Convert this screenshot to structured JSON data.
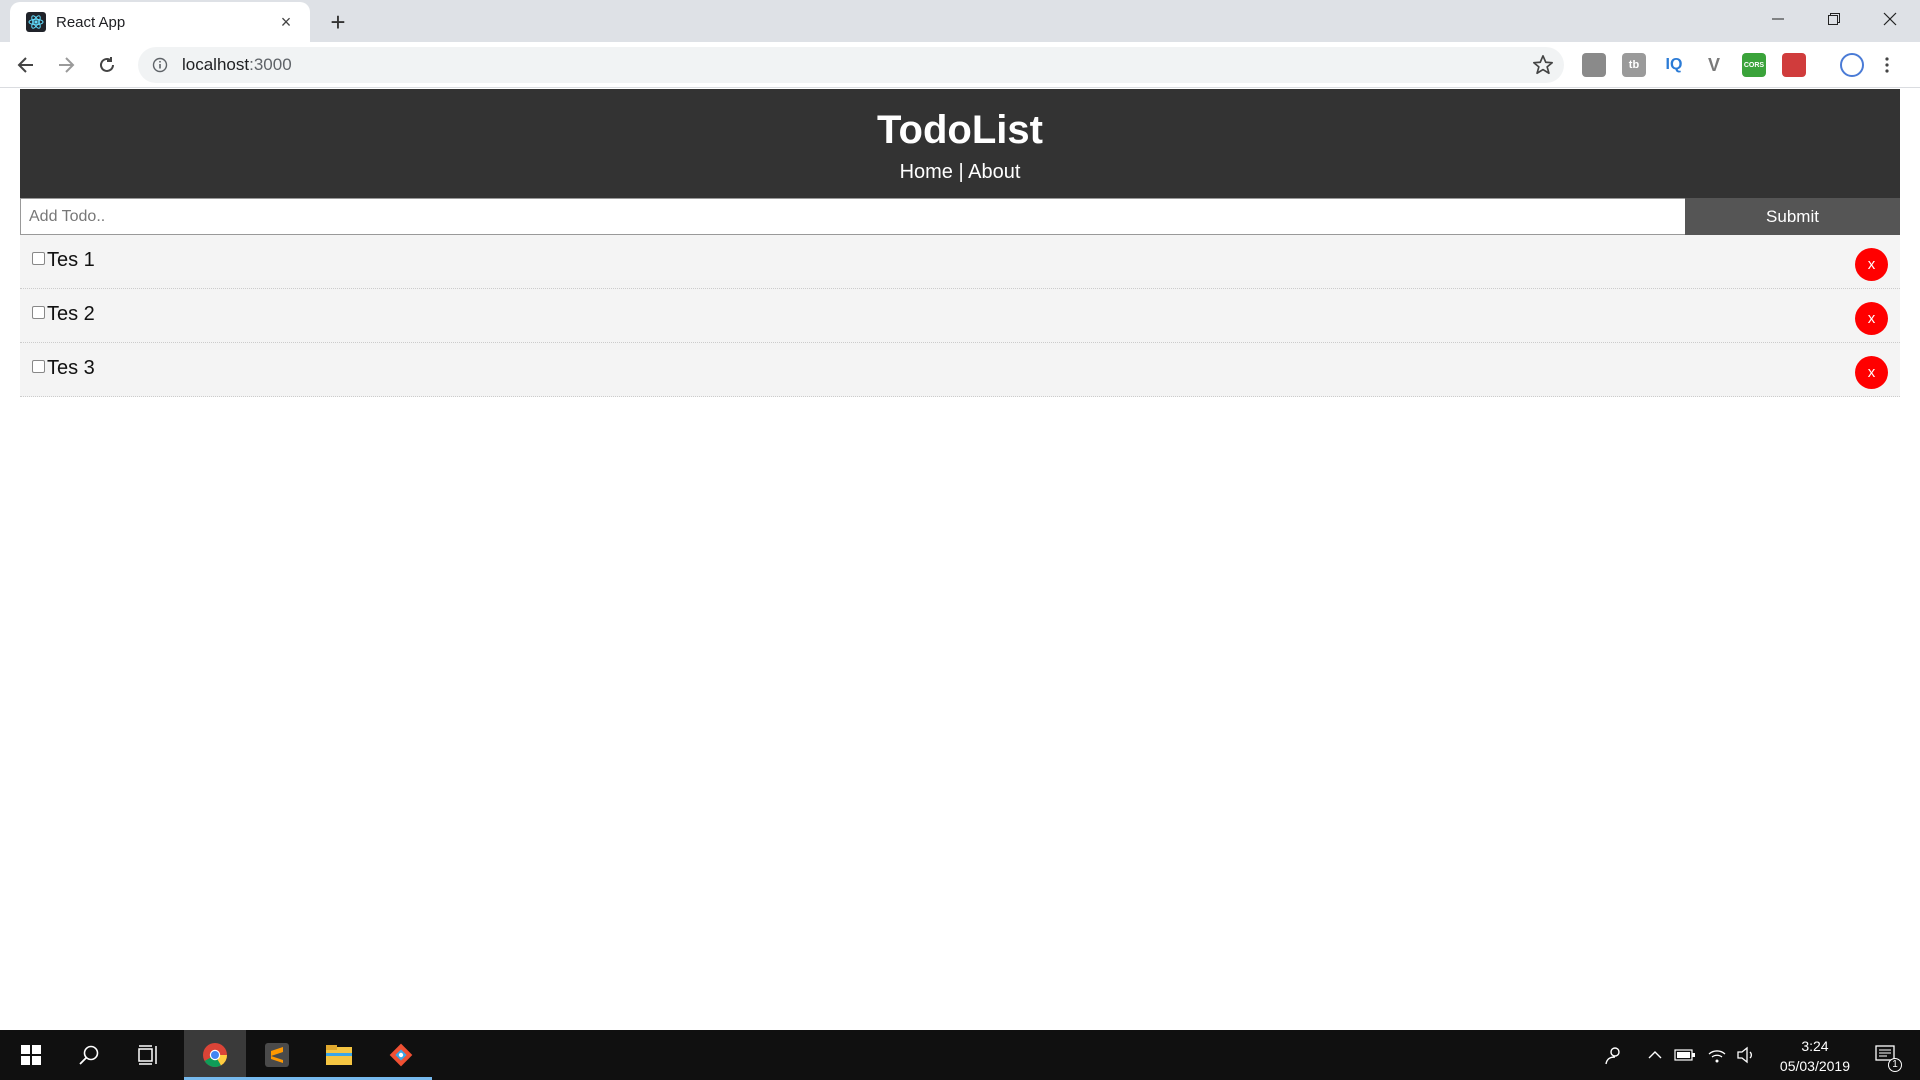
{
  "browser": {
    "tab_title": "React App",
    "new_tab_symbol": "+",
    "tab_close_symbol": "×",
    "url_host": "localhost",
    "url_port": ":3000",
    "extensions": [
      {
        "icon": "profile-ext-icon",
        "text": "",
        "color": "#7a7a7a"
      },
      {
        "icon": "tb-ext-icon",
        "text": "tb",
        "color": "#8a8a8a"
      },
      {
        "icon": "iq-ext-icon",
        "text": "IQ",
        "color": "#2b7bd6"
      },
      {
        "icon": "vue-ext-icon",
        "text": "V",
        "color": "#7a7a7a"
      },
      {
        "icon": "cors-ext-icon",
        "text": "CORS",
        "color": "#3aa33a"
      },
      {
        "icon": "redux-ext-icon",
        "text": "",
        "color": "#d03c3c"
      },
      {
        "icon": "avatar-ext-icon",
        "text": "",
        "color": "#4a7bd6"
      }
    ]
  },
  "app": {
    "title": "TodoList",
    "nav": {
      "home": "Home",
      "separator": " | ",
      "about": "About"
    },
    "form": {
      "placeholder": "Add Todo..",
      "submit_label": "Submit"
    },
    "todos": [
      {
        "title": "Tes 1",
        "completed": false,
        "delete_label": "x"
      },
      {
        "title": "Tes 2",
        "completed": false,
        "delete_label": "x"
      },
      {
        "title": "Tes 3",
        "completed": false,
        "delete_label": "x"
      }
    ],
    "colors": {
      "header_bg": "#333333",
      "delete_bg": "#ff0000",
      "submit_bg": "#555555",
      "item_bg": "#f4f4f4"
    }
  },
  "taskbar": {
    "apps": [
      "chrome-icon",
      "sublime-text-icon",
      "file-explorer-icon",
      "git-icon"
    ],
    "time": "3:24",
    "date": "05/03/2019",
    "notification_count": "1"
  }
}
